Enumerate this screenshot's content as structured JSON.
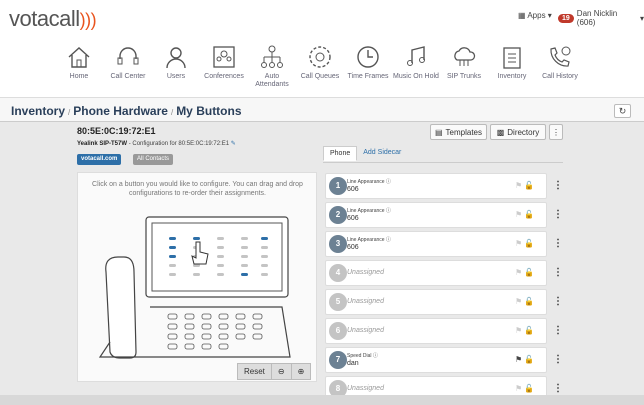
{
  "brand": {
    "name": "votacall"
  },
  "header": {
    "apps_label": "Apps",
    "badge_count": "19",
    "user_name": "Dan Nicklin (606)"
  },
  "nav": [
    {
      "label": "Home",
      "icon": "home-icon"
    },
    {
      "label": "Call Center",
      "icon": "headset-icon"
    },
    {
      "label": "Users",
      "icon": "user-icon"
    },
    {
      "label": "Conferences",
      "icon": "conference-icon"
    },
    {
      "label": "Auto Attendants",
      "icon": "attendant-icon"
    },
    {
      "label": "Call Queues",
      "icon": "queue-icon"
    },
    {
      "label": "Time Frames",
      "icon": "clock-icon"
    },
    {
      "label": "Music On Hold",
      "icon": "music-icon"
    },
    {
      "label": "SIP Trunks",
      "icon": "cloud-icon"
    },
    {
      "label": "Inventory",
      "icon": "clipboard-icon"
    },
    {
      "label": "Call History",
      "icon": "phone-clock-icon"
    }
  ],
  "breadcrumb": [
    "Inventory",
    "Phone Hardware",
    "My Buttons"
  ],
  "device": {
    "mac": "80:5E:0C:19:72:E1",
    "model": "Yealink SIP-T57W",
    "config_text": "- Configuration for 80:5E:0C:19:72:E1",
    "tag_votacall": "votacall.com",
    "tag_contacts": "All Contacts"
  },
  "buttons": {
    "templates": "Templates",
    "directory": "Directory"
  },
  "hint": "Click on a button you would like to configure. You can drag and drop configurations to re-order their assignments.",
  "toolbar": {
    "reset": "Reset",
    "zoom_out": "⊖",
    "zoom_in": "⊕"
  },
  "tabs": {
    "phone": "Phone",
    "sidecar": "Add Sidecar"
  },
  "keys": [
    {
      "num": "1",
      "type": "Line Appearance",
      "value": "606",
      "assigned": true
    },
    {
      "num": "2",
      "type": "Line Appearance",
      "value": "606",
      "assigned": true
    },
    {
      "num": "3",
      "type": "Line Appearance",
      "value": "606",
      "assigned": true
    },
    {
      "num": "4",
      "type": "",
      "value": "Unassigned",
      "assigned": false
    },
    {
      "num": "5",
      "type": "",
      "value": "Unassigned",
      "assigned": false
    },
    {
      "num": "6",
      "type": "",
      "value": "Unassigned",
      "assigned": false
    },
    {
      "num": "7",
      "type": "Speed Dial",
      "value": "dan",
      "assigned": true
    },
    {
      "num": "8",
      "type": "",
      "value": "Unassigned",
      "assigned": false
    }
  ],
  "colors": {
    "accent": "#2d6fa8",
    "brand_orange": "#e9541e",
    "badge": "#c0392b"
  }
}
